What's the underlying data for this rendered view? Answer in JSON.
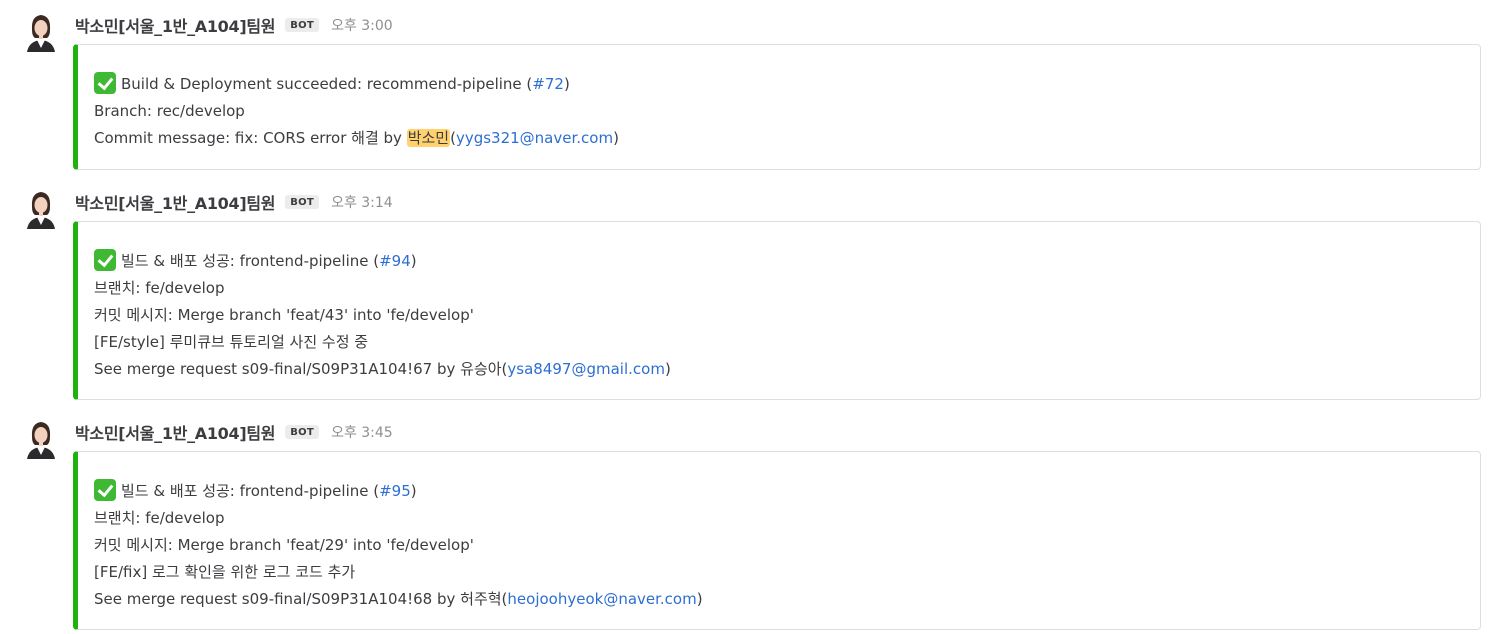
{
  "colors": {
    "accent_bar": "#1fb20e",
    "link": "#2d6fd1",
    "mention_highlight": "#ffd26e"
  },
  "posts": [
    {
      "author": "박소민[서울_1반_A104]팀원",
      "badge": "BOT",
      "time": "오후 3:00",
      "lines": [
        {
          "text": "Build & Deployment succeeded: recommend-pipeline (",
          "link": "#72",
          "after": ")"
        },
        {
          "text": "Branch: rec/develop"
        },
        {
          "text": "Commit message: fix: CORS error 해결 by ",
          "mention": "박소민",
          "paren_open": "(",
          "email": "yygs321@naver.com",
          "after": ")"
        }
      ]
    },
    {
      "author": "박소민[서울_1반_A104]팀원",
      "badge": "BOT",
      "time": "오후 3:14",
      "lines": [
        {
          "text": "빌드 & 배포 성공: frontend-pipeline (",
          "link": "#94",
          "after": ")"
        },
        {
          "text": "브랜치: fe/develop"
        },
        {
          "text": "커밋 메시지: Merge branch 'feat/43' into 'fe/develop'"
        },
        {
          "text": "[FE/style] 루미큐브 튜토리얼 사진 수정 중"
        },
        {
          "text": "See merge request s09-final/S09P31A104!67 by 유승아(",
          "email": "ysa8497@gmail.com",
          "after": ")"
        }
      ]
    },
    {
      "author": "박소민[서울_1반_A104]팀원",
      "badge": "BOT",
      "time": "오후 3:45",
      "lines": [
        {
          "text": "빌드 & 배포 성공: frontend-pipeline (",
          "link": "#95",
          "after": ")"
        },
        {
          "text": "브랜치: fe/develop"
        },
        {
          "text": "커밋 메시지: Merge branch 'feat/29' into 'fe/develop'"
        },
        {
          "text": "[FE/fix] 로그 확인을 위한 로그 코드 추가"
        },
        {
          "text": "See merge request s09-final/S09P31A104!68 by 허주혁(",
          "email": "heojoohyeok@naver.com",
          "after": ")"
        }
      ]
    }
  ]
}
